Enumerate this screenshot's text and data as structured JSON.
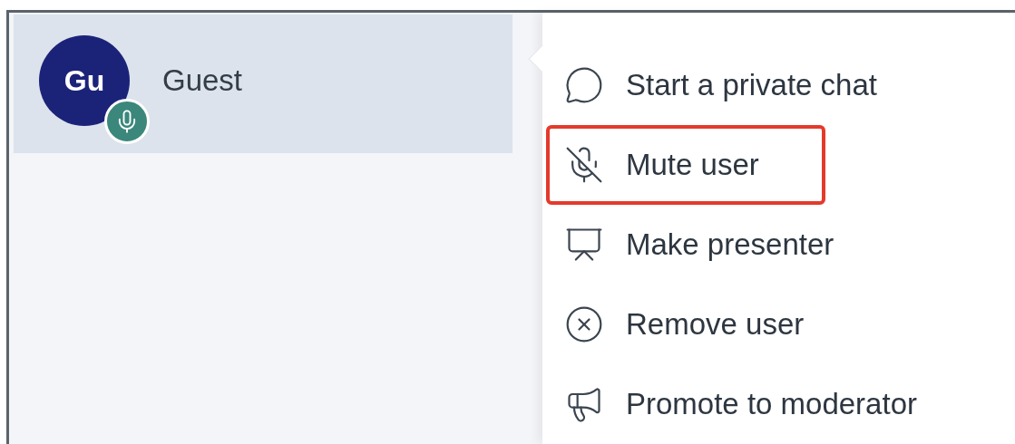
{
  "user": {
    "initials": "Gu",
    "name": "Guest",
    "selected": true,
    "mic_on": true
  },
  "menu": [
    {
      "kind": "chat",
      "label": "Start a private chat",
      "highlighted": false
    },
    {
      "kind": "mute",
      "label": "Mute user",
      "highlighted": true
    },
    {
      "kind": "presenter",
      "label": "Make presenter",
      "highlighted": false
    },
    {
      "kind": "remove",
      "label": "Remove user",
      "highlighted": false
    },
    {
      "kind": "promote",
      "label": "Promote to moderator",
      "highlighted": false
    }
  ]
}
